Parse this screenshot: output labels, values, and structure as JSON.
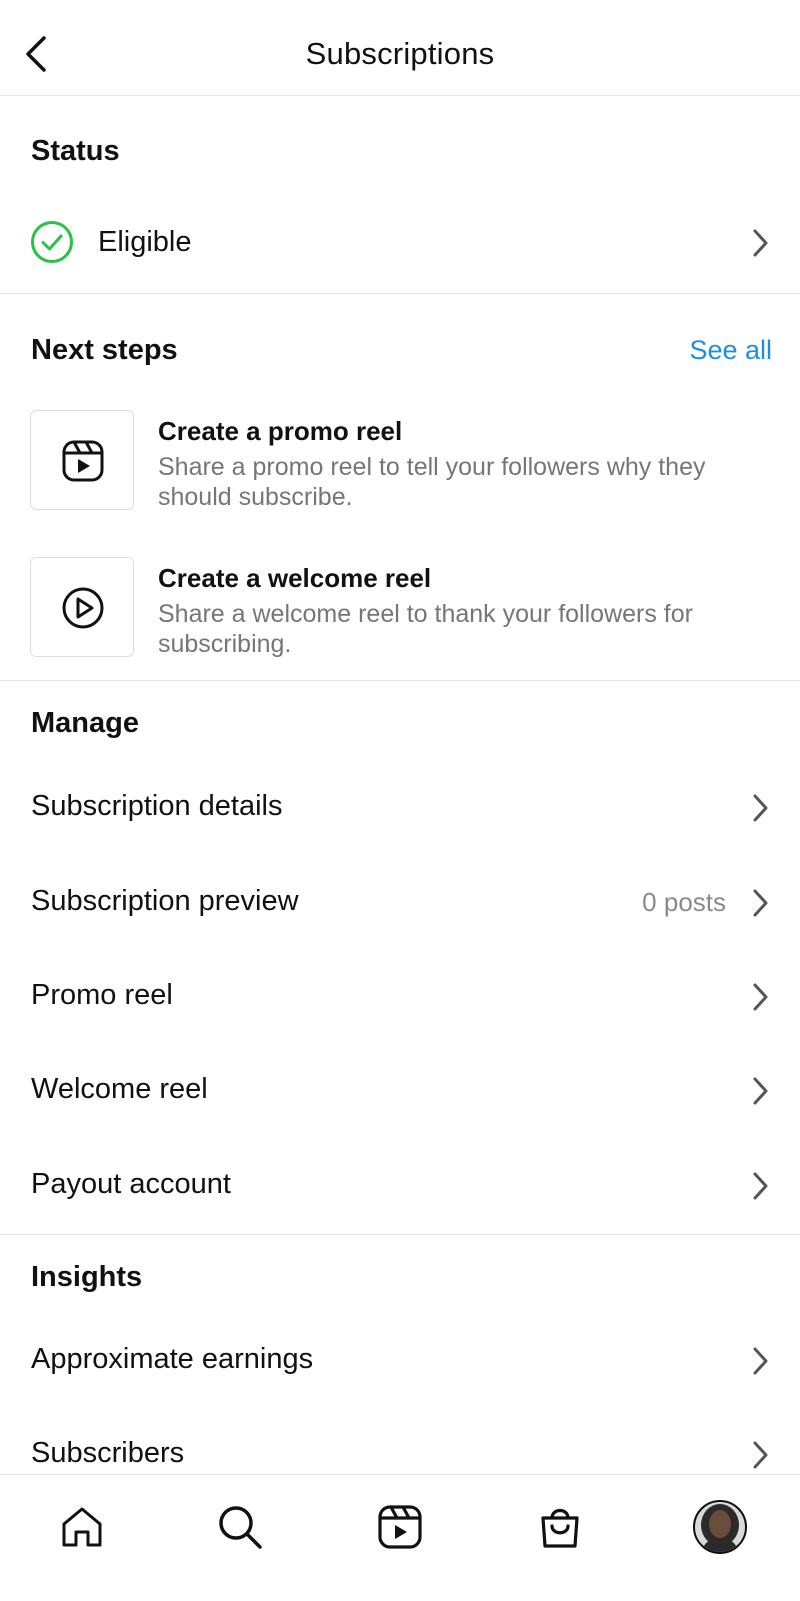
{
  "header": {
    "title": "Subscriptions",
    "back_icon": "chevron-left-icon"
  },
  "status": {
    "heading": "Status",
    "value": "Eligible",
    "icon": "check-circle-icon",
    "icon_color": "#2bc244"
  },
  "next_steps": {
    "heading": "Next steps",
    "see_all": "See all",
    "see_all_color": "#1c8fe3",
    "items": [
      {
        "icon": "reels-icon",
        "title": "Create a promo reel",
        "description": "Share a promo reel to tell your followers why they should subscribe."
      },
      {
        "icon": "play-circle-icon",
        "title": "Create a welcome reel",
        "description": "Share a welcome reel to thank your followers for subscribing."
      }
    ]
  },
  "manage": {
    "heading": "Manage",
    "items": [
      {
        "label": "Subscription details",
        "value": ""
      },
      {
        "label": "Subscription preview",
        "value": "0 posts"
      },
      {
        "label": "Promo reel",
        "value": ""
      },
      {
        "label": "Welcome reel",
        "value": ""
      },
      {
        "label": "Payout account",
        "value": ""
      }
    ]
  },
  "insights": {
    "heading": "Insights",
    "items": [
      {
        "label": "Approximate earnings"
      },
      {
        "label": "Subscribers"
      }
    ]
  },
  "tabbar": {
    "items": [
      {
        "name": "home-icon"
      },
      {
        "name": "search-icon"
      },
      {
        "name": "reels-icon"
      },
      {
        "name": "shop-bag-icon"
      },
      {
        "name": "profile-avatar"
      }
    ]
  }
}
